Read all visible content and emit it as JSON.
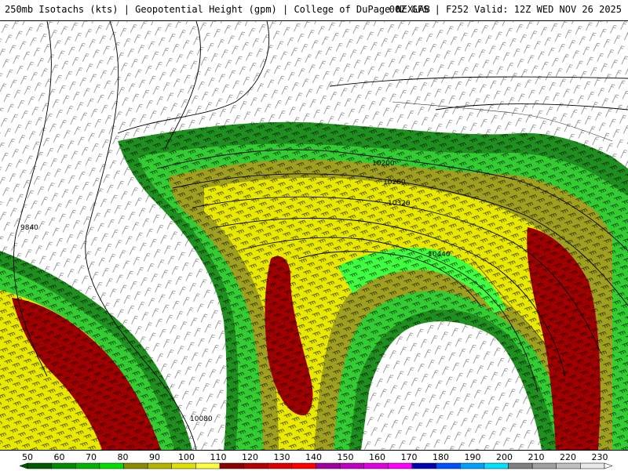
{
  "header": {
    "left": "250mb Isotachs (kts) | Geopotential Height (gpm) | College of DuPage NEXLAB",
    "right": "00Z GFS | F252 Valid: 12Z WED NOV 26 2025"
  },
  "contour_labels": [
    "10200",
    "10260",
    "10320",
    "10440",
    "9840",
    "10080"
  ],
  "colorbar": {
    "tick_labels": [
      "50",
      "60",
      "70",
      "80",
      "90",
      "100",
      "110",
      "120",
      "130",
      "140",
      "150",
      "160",
      "170",
      "180",
      "190",
      "200",
      "210",
      "220",
      "230"
    ],
    "colors": [
      "#005a00",
      "#008a00",
      "#00b400",
      "#00e000",
      "#8c8c00",
      "#b4b400",
      "#e0e000",
      "#ffff40",
      "#8c0000",
      "#b40000",
      "#e00000",
      "#ff0000",
      "#a000a0",
      "#c000c0",
      "#e000e0",
      "#ff00ff",
      "#0000b4",
      "#0050ff",
      "#00a0ff",
      "#00e0ff",
      "#808080",
      "#a0a0a0",
      "#c0c0c0",
      "#e8e8e8"
    ]
  },
  "isotach_colors": {
    "green_dark": "#1f8f1f",
    "green": "#33cc33",
    "green_light": "#40ff40",
    "olive": "#a0a020",
    "yellow": "#e8e800",
    "red": "#a00000"
  }
}
